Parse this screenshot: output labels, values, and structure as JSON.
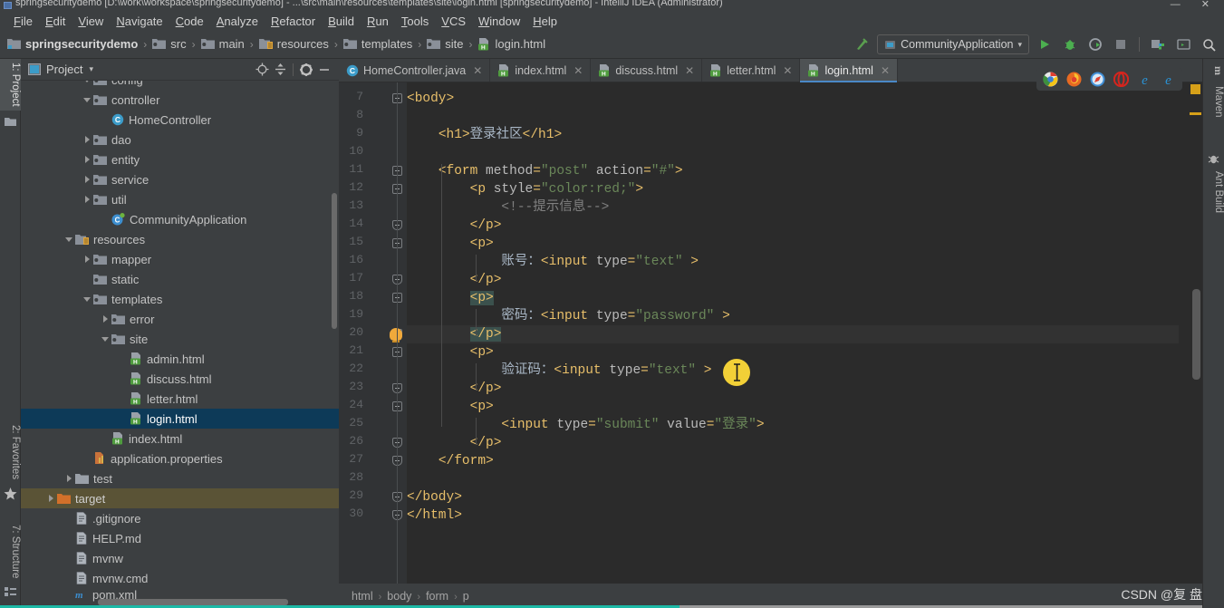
{
  "window": {
    "title": "springsecuritydemo [D:\\work\\workspace\\springsecuritydemo] - ...\\src\\main\\resources\\templates\\site\\login.html [springsecuritydemo] - IntelliJ IDEA (Administrator)",
    "controls": "—  ✕"
  },
  "menu": {
    "items": [
      {
        "label": "File"
      },
      {
        "label": "Edit"
      },
      {
        "label": "View"
      },
      {
        "label": "Navigate"
      },
      {
        "label": "Code"
      },
      {
        "label": "Analyze"
      },
      {
        "label": "Refactor"
      },
      {
        "label": "Build"
      },
      {
        "label": "Run"
      },
      {
        "label": "Tools"
      },
      {
        "label": "VCS"
      },
      {
        "label": "Window"
      },
      {
        "label": "Help"
      }
    ]
  },
  "navbar": {
    "breadcrumb": [
      {
        "label": "springsecuritydemo",
        "icon": "module-icon"
      },
      {
        "label": "src",
        "icon": "folder-icon"
      },
      {
        "label": "main",
        "icon": "folder-icon"
      },
      {
        "label": "resources",
        "icon": "resources-folder-icon"
      },
      {
        "label": "templates",
        "icon": "folder-icon"
      },
      {
        "label": "site",
        "icon": "folder-icon"
      },
      {
        "label": "login.html",
        "icon": "html-file-icon"
      }
    ],
    "separator": "›",
    "run_configuration": "CommunityApplication",
    "buttons": [
      {
        "name": "build-project-button",
        "icon": "hammer-icon"
      },
      {
        "name": "run-button",
        "icon": "play-icon"
      },
      {
        "name": "debug-button",
        "icon": "bug-icon"
      },
      {
        "name": "run-with-coverage-button",
        "icon": "coverage-icon"
      },
      {
        "name": "stop-button",
        "icon": "stop-icon"
      },
      {
        "name": "project-structure-button",
        "icon": "project-structure-icon"
      },
      {
        "name": "terminal-button",
        "icon": "terminal-icon"
      },
      {
        "name": "search-everywhere-button",
        "icon": "search-icon"
      }
    ]
  },
  "left_tool_strip": {
    "tabs": [
      {
        "label": "1: Project",
        "active": true
      },
      {
        "label": "2: Favorites",
        "active": false
      },
      {
        "label": "7: Structure",
        "active": false
      }
    ]
  },
  "right_tool_strip": {
    "tabs": [
      {
        "label": "Maven"
      },
      {
        "label": "Ant Build"
      }
    ]
  },
  "project_panel": {
    "title": "Project",
    "caret": "▾",
    "actions": [
      {
        "name": "select-opened-file-button",
        "icon": "crosshair-icon"
      },
      {
        "name": "collapse-all-button",
        "icon": "collapse-all-icon"
      },
      {
        "name": "settings-button",
        "icon": "gear-icon"
      },
      {
        "name": "hide-button",
        "icon": "minimize-icon"
      }
    ],
    "tree": [
      {
        "label": "config",
        "indent": 3,
        "twisty": "down",
        "icon": "folder-icon",
        "state": "clipped"
      },
      {
        "label": "controller",
        "indent": 3,
        "twisty": "down",
        "icon": "folder-icon",
        "state": "normal"
      },
      {
        "label": "HomeController",
        "indent": 4,
        "twisty": "none",
        "icon": "java-class-icon",
        "state": "normal"
      },
      {
        "label": "dao",
        "indent": 3,
        "twisty": "right",
        "icon": "folder-icon",
        "state": "normal"
      },
      {
        "label": "entity",
        "indent": 3,
        "twisty": "right",
        "icon": "folder-icon",
        "state": "normal"
      },
      {
        "label": "service",
        "indent": 3,
        "twisty": "right",
        "icon": "folder-icon",
        "state": "normal"
      },
      {
        "label": "util",
        "indent": 3,
        "twisty": "right",
        "icon": "folder-icon",
        "state": "normal"
      },
      {
        "label": "CommunityApplication",
        "indent": 4,
        "twisty": "none",
        "icon": "spring-boot-icon",
        "state": "normal"
      },
      {
        "label": "resources",
        "indent": 2,
        "twisty": "down",
        "icon": "resources-folder-icon",
        "state": "normal"
      },
      {
        "label": "mapper",
        "indent": 3,
        "twisty": "right",
        "icon": "folder-icon",
        "state": "normal"
      },
      {
        "label": "static",
        "indent": 3,
        "twisty": "none",
        "icon": "folder-icon",
        "state": "normal"
      },
      {
        "label": "templates",
        "indent": 3,
        "twisty": "down",
        "icon": "folder-icon",
        "state": "normal"
      },
      {
        "label": "error",
        "indent": 4,
        "twisty": "right",
        "icon": "folder-icon",
        "state": "normal"
      },
      {
        "label": "site",
        "indent": 4,
        "twisty": "down",
        "icon": "folder-icon",
        "state": "normal"
      },
      {
        "label": "admin.html",
        "indent": 5,
        "twisty": "none",
        "icon": "html-file-icon",
        "state": "normal"
      },
      {
        "label": "discuss.html",
        "indent": 5,
        "twisty": "none",
        "icon": "html-file-icon",
        "state": "normal"
      },
      {
        "label": "letter.html",
        "indent": 5,
        "twisty": "none",
        "icon": "html-file-icon",
        "state": "normal"
      },
      {
        "label": "login.html",
        "indent": 5,
        "twisty": "none",
        "icon": "html-file-icon",
        "state": "selected"
      },
      {
        "label": "index.html",
        "indent": 4,
        "twisty": "none",
        "icon": "html-file-icon",
        "state": "normal"
      },
      {
        "label": "application.properties",
        "indent": 3,
        "twisty": "none",
        "icon": "properties-icon",
        "state": "normal"
      },
      {
        "label": "test",
        "indent": 2,
        "twisty": "right",
        "icon": "plain-folder-icon",
        "state": "normal"
      },
      {
        "label": "target",
        "indent": 1,
        "twisty": "right",
        "icon": "orange-folder-icon",
        "state": "amber"
      },
      {
        "label": ".gitignore",
        "indent": 2,
        "twisty": "none",
        "icon": "file-icon",
        "state": "normal"
      },
      {
        "label": "HELP.md",
        "indent": 2,
        "twisty": "none",
        "icon": "file-icon",
        "state": "normal"
      },
      {
        "label": "mvnw",
        "indent": 2,
        "twisty": "none",
        "icon": "file-icon",
        "state": "normal"
      },
      {
        "label": "mvnw.cmd",
        "indent": 2,
        "twisty": "none",
        "icon": "file-icon",
        "state": "normal"
      },
      {
        "label": "pom.xml",
        "indent": 2,
        "twisty": "none",
        "icon": "maven-icon",
        "state": "clipped-bottom"
      }
    ]
  },
  "editor": {
    "tabs": [
      {
        "label": "HomeController.java",
        "icon": "java-class-icon",
        "active": false,
        "close": "✕"
      },
      {
        "label": "index.html",
        "icon": "html-file-icon",
        "active": false,
        "close": "✕"
      },
      {
        "label": "discuss.html",
        "icon": "html-file-icon",
        "active": false,
        "close": "✕"
      },
      {
        "label": "letter.html",
        "icon": "html-file-icon",
        "active": false,
        "close": "✕"
      },
      {
        "label": "login.html",
        "icon": "html-file-icon",
        "active": true,
        "close": "✕"
      }
    ],
    "first_line_number": 7,
    "caret_line": 20,
    "lines": [
      {
        "n": 7,
        "text": "<body>"
      },
      {
        "n": 8,
        "text": ""
      },
      {
        "n": 9,
        "text": "    <h1>登录社区</h1>"
      },
      {
        "n": 10,
        "text": ""
      },
      {
        "n": 11,
        "text": "    <form method=\"post\" action=\"#\">"
      },
      {
        "n": 12,
        "text": "        <p style=\"color:red;\">"
      },
      {
        "n": 13,
        "text": "            <!--提示信息-->"
      },
      {
        "n": 14,
        "text": "        </p>"
      },
      {
        "n": 15,
        "text": "        <p>"
      },
      {
        "n": 16,
        "text": "            账号：<input type=\"text\" >"
      },
      {
        "n": 17,
        "text": "        </p>"
      },
      {
        "n": 18,
        "text": "        <p>"
      },
      {
        "n": 19,
        "text": "            密码：<input type=\"password\" >"
      },
      {
        "n": 20,
        "text": "        </p>"
      },
      {
        "n": 21,
        "text": "        <p>"
      },
      {
        "n": 22,
        "text": "            验证码：<input type=\"text\" >"
      },
      {
        "n": 23,
        "text": "        </p>"
      },
      {
        "n": 24,
        "text": "        <p>"
      },
      {
        "n": 25,
        "text": "            <input type=\"submit\" value=\"登录\">"
      },
      {
        "n": 26,
        "text": "        </p>"
      },
      {
        "n": 27,
        "text": "    </form>"
      },
      {
        "n": 28,
        "text": ""
      },
      {
        "n": 29,
        "text": "</body>"
      },
      {
        "n": 30,
        "text": "</html>"
      }
    ],
    "browser_bar": [
      {
        "name": "chrome-icon",
        "color": "#dfdfdf"
      },
      {
        "name": "firefox-icon",
        "color": "#e86a22"
      },
      {
        "name": "safari-icon",
        "color": "#3f8ed6"
      },
      {
        "name": "opera-icon",
        "color": "#d5251e"
      },
      {
        "name": "ie-icon",
        "color": "#2b92d4"
      },
      {
        "name": "edge-icon",
        "color": "#2b92d4"
      }
    ]
  },
  "status_bar": {
    "breadcrumb": [
      "html",
      "body",
      "form",
      "p"
    ],
    "separator": "›",
    "watermark": "CSDN @复 盘！"
  },
  "colors": {
    "accent": "#4a88c7",
    "selection": "#0d3a58",
    "tag": "#e8bf6a",
    "string": "#6a8759",
    "text": "#a9b7c6",
    "comment": "#808080",
    "editor_bg": "#2b2b2b",
    "panel_bg": "#3c3f41"
  }
}
